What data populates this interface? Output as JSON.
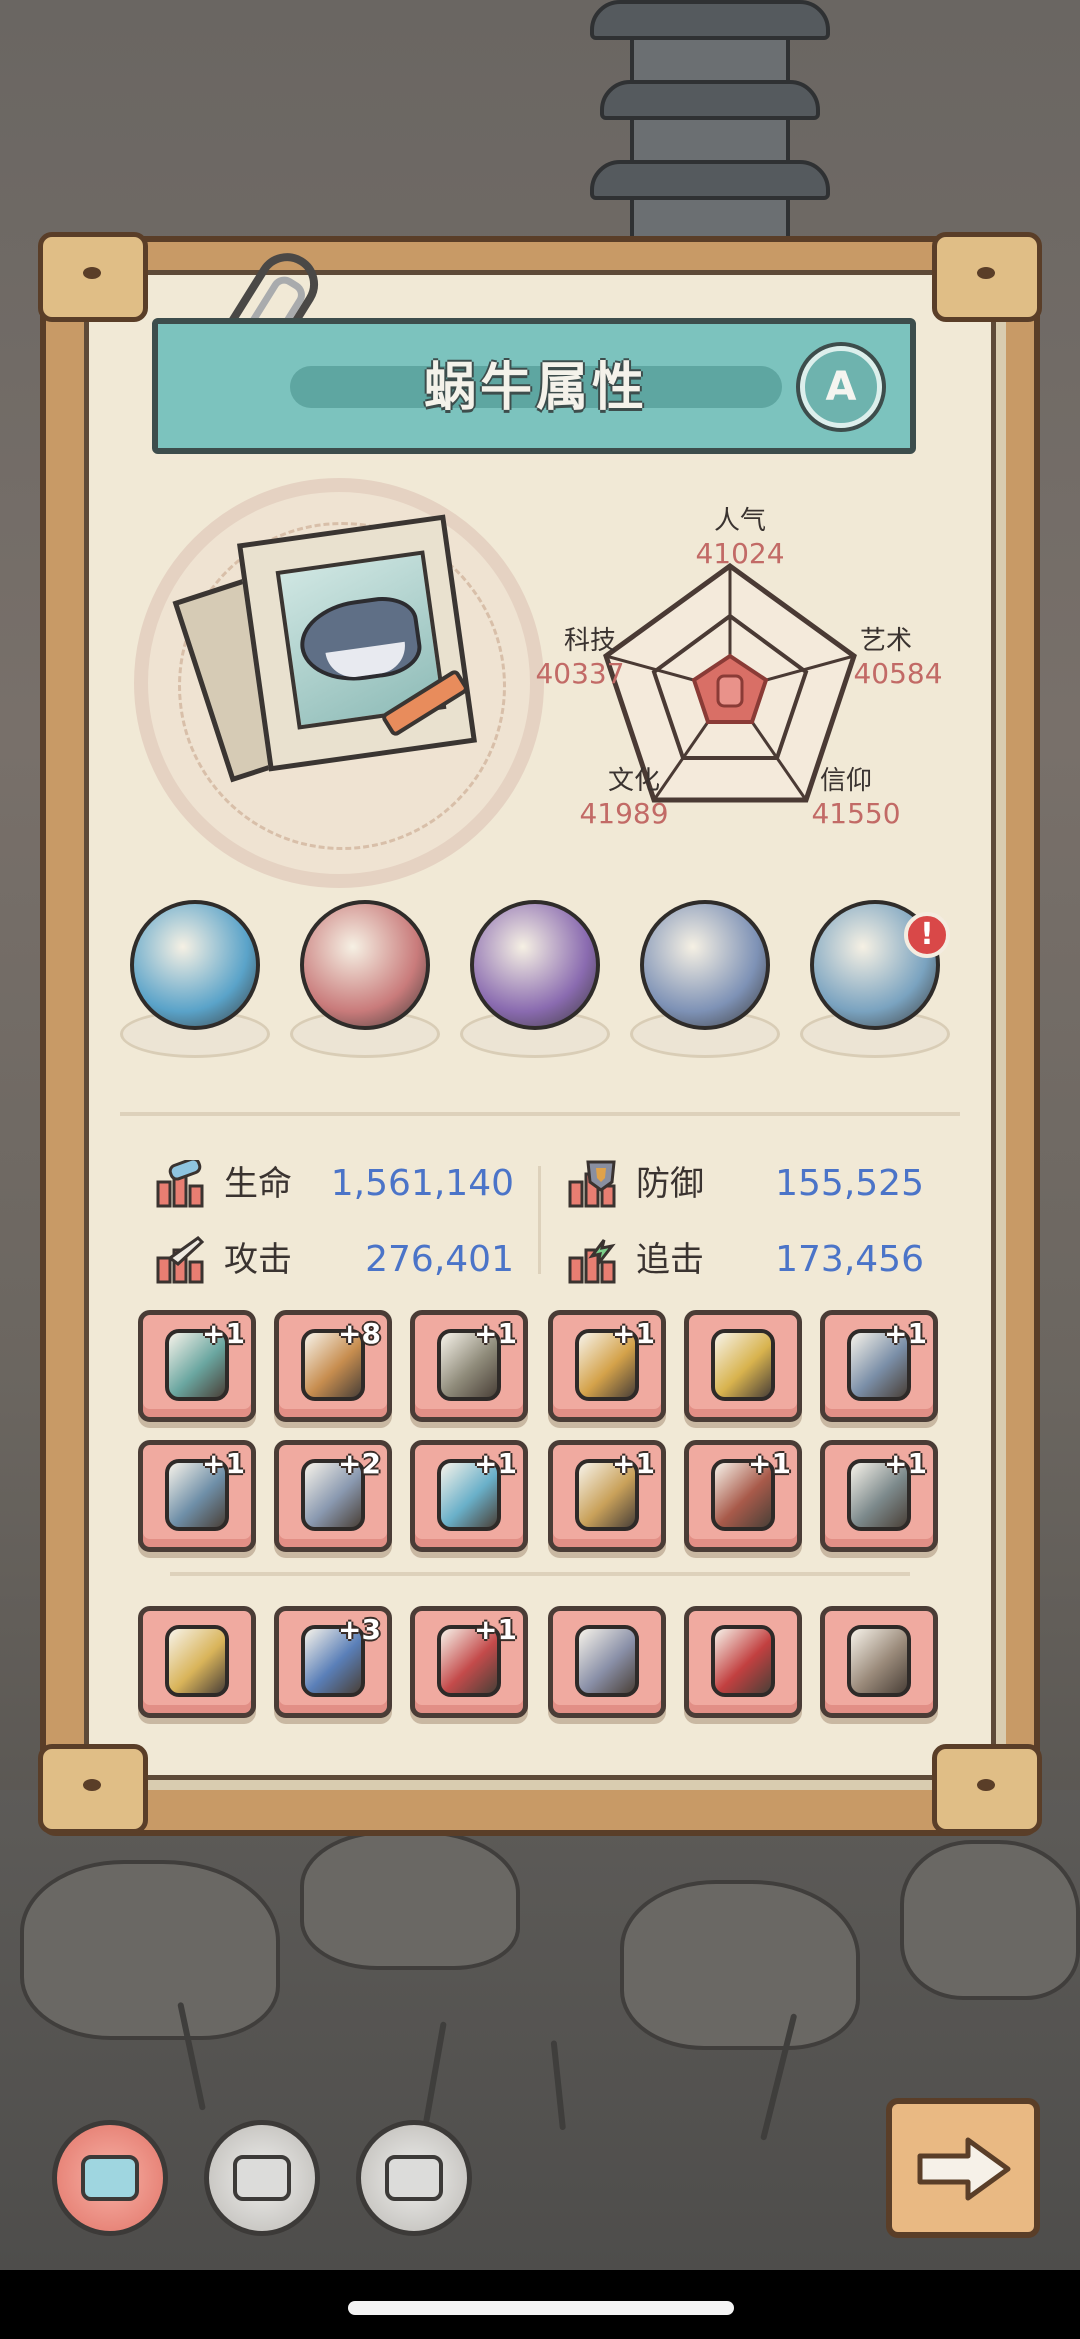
{
  "panel": {
    "title": "蜗牛属性",
    "grade": "A"
  },
  "radar": {
    "popularity": {
      "label": "人气",
      "value": "41024"
    },
    "technology": {
      "label": "科技",
      "value": "40337"
    },
    "art": {
      "label": "艺术",
      "value": "40584"
    },
    "culture": {
      "label": "文化",
      "value": "41989"
    },
    "faith": {
      "label": "信仰",
      "value": "41550"
    }
  },
  "artifacts": [
    {
      "icon": "sea-monster-icon",
      "color": "#5aa3c9"
    },
    {
      "icon": "fanged-mouth-icon",
      "color": "#c97b7b"
    },
    {
      "icon": "cauldron-icon",
      "color": "#8a6bb0"
    },
    {
      "icon": "compass-icon",
      "color": "#7e92b6"
    },
    {
      "icon": "gem-ring-icon",
      "color": "#7aa3c0",
      "notification": "!"
    }
  ],
  "stats": {
    "hp": {
      "label": "生命",
      "value": "1,561,140"
    },
    "defense": {
      "label": "防御",
      "value": "155,525"
    },
    "attack": {
      "label": "攻击",
      "value": "276,401"
    },
    "pursuit": {
      "label": "追击",
      "value": "173,456"
    }
  },
  "equipment_row1": [
    {
      "icon": "trident-icon",
      "level": "+1",
      "color": "#6aa6a0"
    },
    {
      "icon": "armor-icon",
      "level": "+8",
      "color": "#c78d4f"
    },
    {
      "icon": "scales-icon",
      "level": "+1",
      "color": "#8f8b7a"
    },
    {
      "icon": "scepter-icon",
      "level": "+1",
      "color": "#d4a24a"
    },
    {
      "icon": "ring-icon",
      "level": "",
      "color": "#d8b34e"
    },
    {
      "icon": "lantern-icon",
      "level": "+1",
      "color": "#7b8fa8"
    }
  ],
  "equipment_row2": [
    {
      "icon": "bracer-icon",
      "level": "+1",
      "color": "#6f8fa8"
    },
    {
      "icon": "dagger-icon",
      "level": "+2",
      "color": "#8a99b0"
    },
    {
      "icon": "sword-icon",
      "level": "+1",
      "color": "#6ab0c9"
    },
    {
      "icon": "crossbow-icon",
      "level": "+1",
      "color": "#c9a15a"
    },
    {
      "icon": "blaster-icon",
      "level": "+1",
      "color": "#a85a4a"
    },
    {
      "icon": "gauntlet-icon",
      "level": "+1",
      "color": "#7d8a8c"
    }
  ],
  "equipment_row3": [
    {
      "icon": "chest-icon",
      "level": "",
      "color": "#d9b45a"
    },
    {
      "icon": "glove-icon",
      "level": "+3",
      "color": "#5a7fb8"
    },
    {
      "icon": "boot-icon",
      "level": "+1",
      "color": "#c44b4b"
    },
    {
      "icon": "feather-staff-icon",
      "level": "",
      "color": "#8a90a8"
    },
    {
      "icon": "scimitar-icon",
      "level": "",
      "color": "#c24040"
    },
    {
      "icon": "spear-icon",
      "level": "",
      "color": "#9a8a7a"
    }
  ],
  "nav": [
    {
      "icon": "snail-tab-icon",
      "active": true,
      "color": "#e8867a"
    },
    {
      "icon": "robot-tab-icon",
      "active": false,
      "color": "#c8c6c2"
    },
    {
      "icon": "puzzle-tab-icon",
      "active": false,
      "color": "#c8c6c2"
    }
  ],
  "next_button": {
    "icon": "arrow-right-icon"
  }
}
